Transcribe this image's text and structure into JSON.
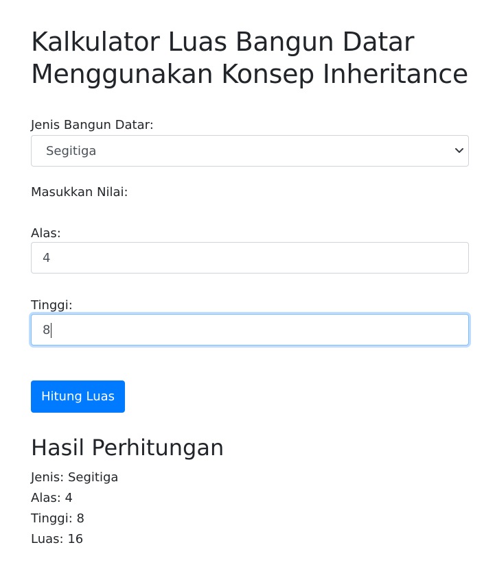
{
  "page": {
    "title_line1": "Kalkulator Luas Bangun Datar",
    "title_line2": "Menggunakan Konsep Inheritance"
  },
  "form": {
    "shape_label": "Jenis Bangun Datar:",
    "shape_selected": "Segitiga",
    "values_label": "Masukkan Nilai:",
    "base_label": "Alas:",
    "base_value": "4",
    "height_label": "Tinggi:",
    "height_value": "8",
    "submit_label": "Hitung Luas"
  },
  "result": {
    "heading": "Hasil Perhitungan",
    "lines": [
      "Jenis: Segitiga",
      "Alas: 4",
      "Tinggi: 8",
      "Luas: 16"
    ]
  },
  "colors": {
    "primary": "#007bff",
    "text": "#212529",
    "border": "#ced4da",
    "focus_border": "#80bdff"
  },
  "icons": {
    "select_arrow": "chevron-down-icon"
  }
}
